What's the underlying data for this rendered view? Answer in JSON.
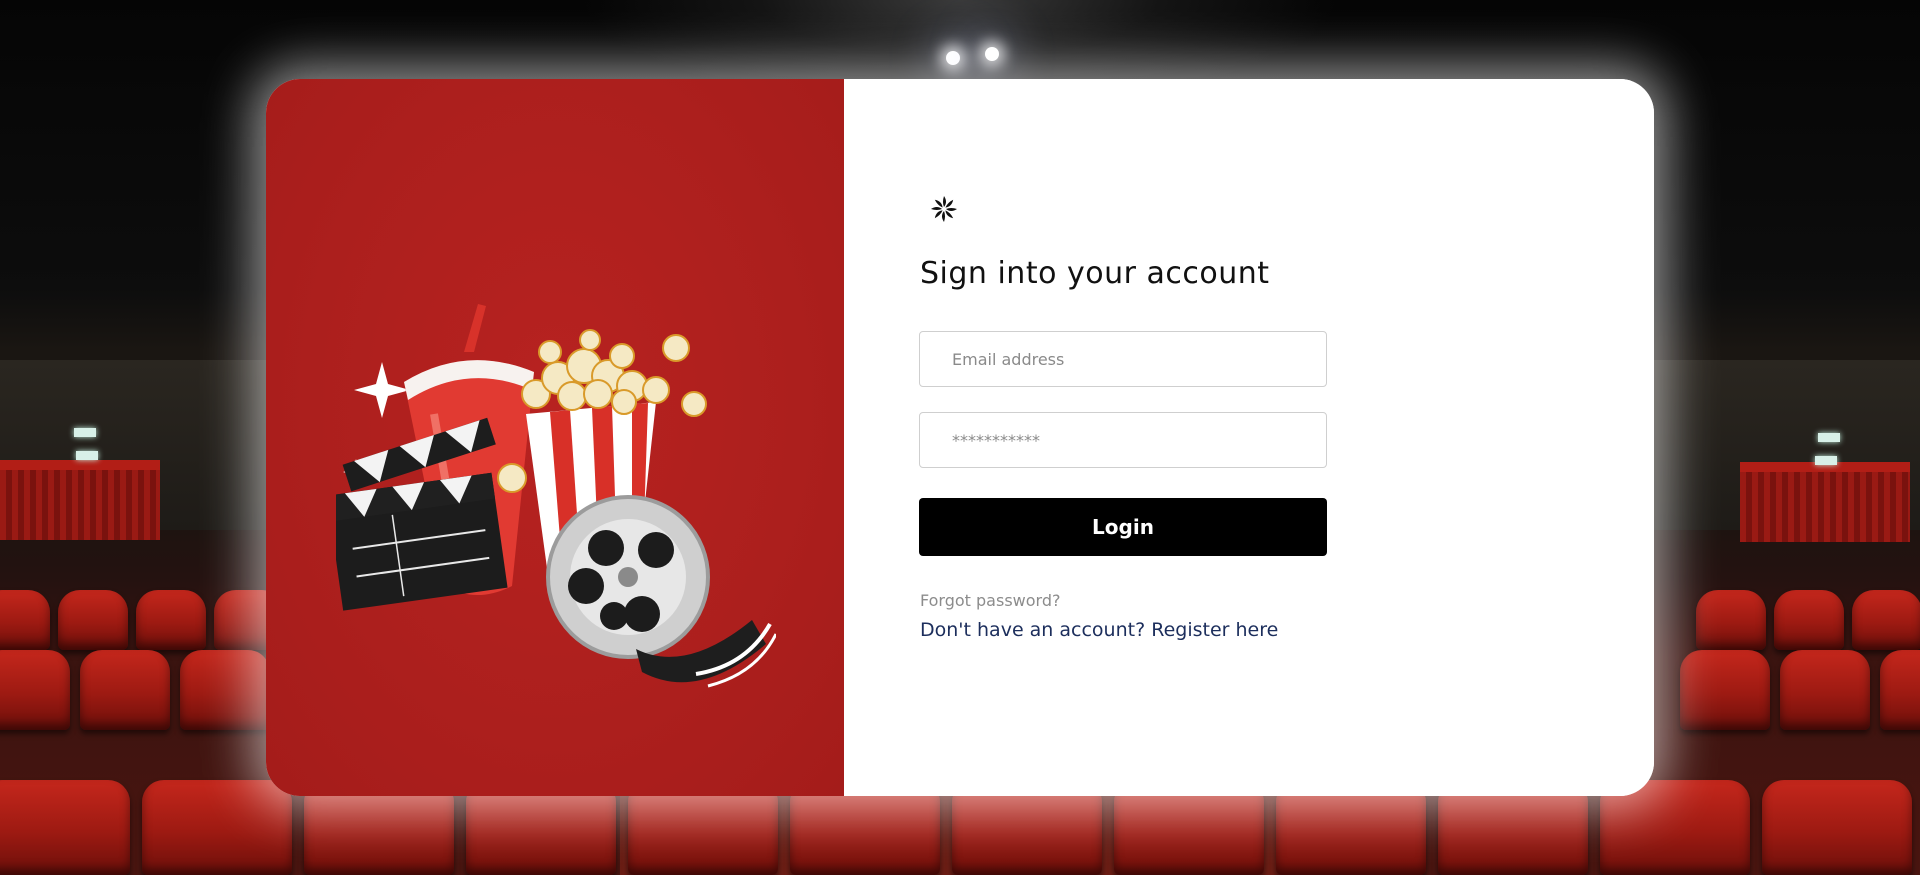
{
  "colors": {
    "left_panel": "#ac1f1d",
    "login_button": "#000000",
    "register_link": "#1c2e5c",
    "forgot_link": "#8c8c8c"
  },
  "logo": {
    "icon": "loader-icon"
  },
  "illustration": {
    "icon": "cinema-illustration"
  },
  "signin": {
    "title": "Sign into your account",
    "email": {
      "placeholder": "Email address",
      "value": ""
    },
    "password": {
      "placeholder": "***********",
      "value": ""
    },
    "login_label": "Login",
    "forgot_label": "Forgot password?",
    "register_prefix": "Don't have an account?",
    "register_link": "Register here"
  }
}
